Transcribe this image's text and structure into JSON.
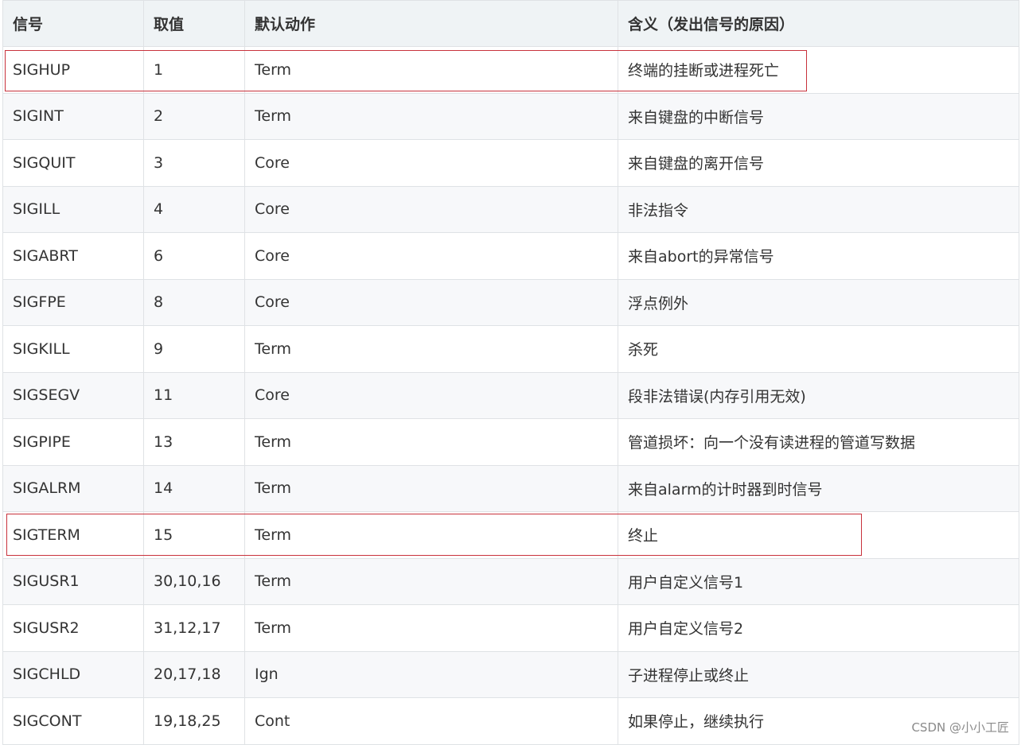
{
  "table": {
    "headers": [
      "信号",
      "取值",
      "默认动作",
      "含义（发出信号的原因）"
    ],
    "rows": [
      [
        "SIGHUP",
        "1",
        "Term",
        "终端的挂断或进程死亡"
      ],
      [
        "SIGINT",
        "2",
        "Term",
        "来自键盘的中断信号"
      ],
      [
        "SIGQUIT",
        "3",
        "Core",
        "来自键盘的离开信号"
      ],
      [
        "SIGILL",
        "4",
        "Core",
        "非法指令"
      ],
      [
        "SIGABRT",
        "6",
        "Core",
        "来自abort的异常信号"
      ],
      [
        "SIGFPE",
        "8",
        "Core",
        "浮点例外"
      ],
      [
        "SIGKILL",
        "9",
        "Term",
        "杀死"
      ],
      [
        "SIGSEGV",
        "11",
        "Core",
        "段非法错误(内存引用无效)"
      ],
      [
        "SIGPIPE",
        "13",
        "Term",
        "管道损坏：向一个没有读进程的管道写数据"
      ],
      [
        "SIGALRM",
        "14",
        "Term",
        "来自alarm的计时器到时信号"
      ],
      [
        "SIGTERM",
        "15",
        "Term",
        "终止"
      ],
      [
        "SIGUSR1",
        "30,10,16",
        "Term",
        "用户自定义信号1"
      ],
      [
        "SIGUSR2",
        "31,12,17",
        "Term",
        "用户自定义信号2"
      ],
      [
        "SIGCHLD",
        "20,17,18",
        "Ign",
        "子进程停止或终止"
      ],
      [
        "SIGCONT",
        "19,18,25",
        "Cont",
        "如果停止，继续执行"
      ]
    ]
  },
  "highlight_color": "#c8323c",
  "watermark": "CSDN @小小工匠"
}
